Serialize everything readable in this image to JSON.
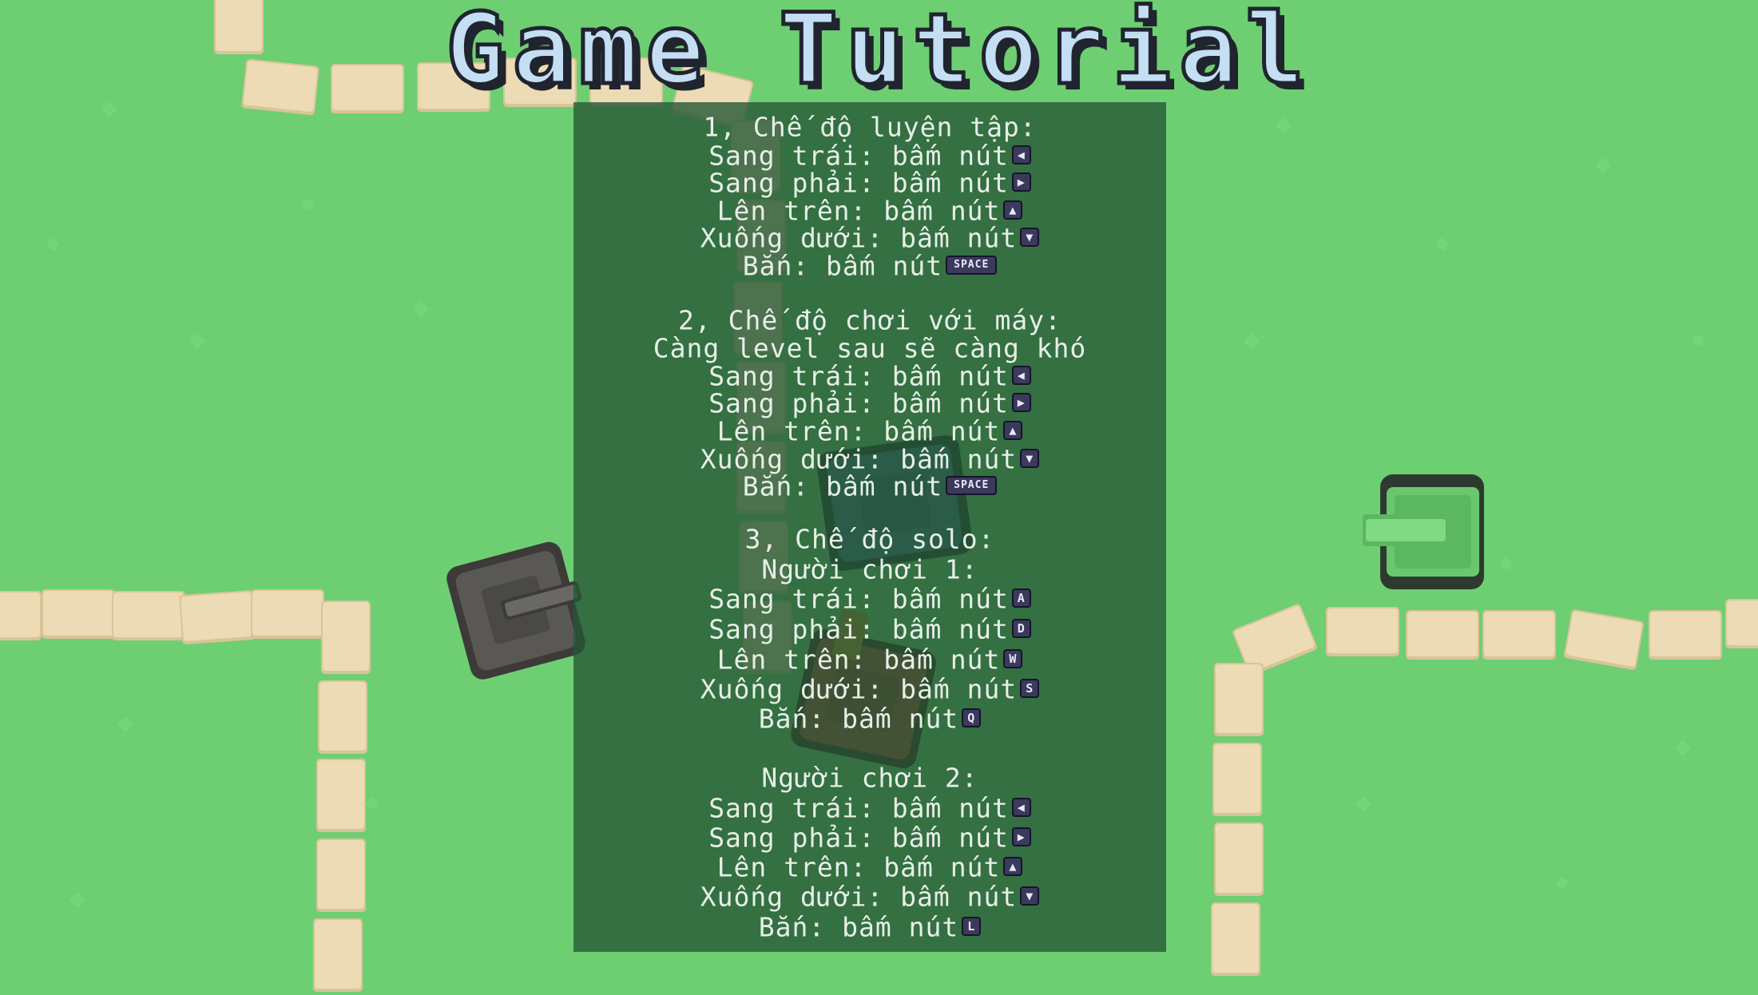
{
  "title": "Game Tutorial",
  "sections": [
    {
      "lines": [
        {
          "text": "1, Chế độ luyện tập:"
        },
        {
          "text": "Sang trái: bấm nút",
          "key": "◀",
          "key_name": "left-arrow-key-icon"
        },
        {
          "text": "Sang phải: bấm nút",
          "key": "▶",
          "key_name": "right-arrow-key-icon"
        },
        {
          "text": "Lên trên: bấm nút",
          "key": "▲",
          "key_name": "up-arrow-key-icon"
        },
        {
          "text": "Xuống dưới: bấm nút",
          "key": "▼",
          "key_name": "down-arrow-key-icon"
        },
        {
          "text": "Bắn: bấm nút",
          "key": "SPACE",
          "key_name": "space-key-icon"
        }
      ]
    },
    {
      "lines": [
        {
          "text": "2, Chế độ chơi với máy:"
        },
        {
          "text": "Càng level sau sẽ càng khó"
        },
        {
          "text": "Sang trái: bấm nút",
          "key": "◀",
          "key_name": "left-arrow-key-icon"
        },
        {
          "text": "Sang phải: bấm nút",
          "key": "▶",
          "key_name": "right-arrow-key-icon"
        },
        {
          "text": "Lên trên: bấm nút",
          "key": "▲",
          "key_name": "up-arrow-key-icon"
        },
        {
          "text": "Xuống dưới: bấm nút",
          "key": "▼",
          "key_name": "down-arrow-key-icon"
        },
        {
          "text": "Bắn: bấm nút",
          "key": "SPACE",
          "key_name": "space-key-icon"
        }
      ]
    },
    {
      "lines": [
        {
          "text": "3, Chế độ solo:"
        },
        {
          "text": "Người chơi 1:"
        },
        {
          "text": "Sang trái: bấm nút",
          "key": "A",
          "key_name": "a-key-icon"
        },
        {
          "text": "Sang phải: bấm nút",
          "key": "D",
          "key_name": "d-key-icon"
        },
        {
          "text": "Lên trên: bấm nút",
          "key": "W",
          "key_name": "w-key-icon"
        },
        {
          "text": "Xuống dưới: bấm nút",
          "key": "S",
          "key_name": "s-key-icon"
        },
        {
          "text": "Bắn: bấm nút",
          "key": "Q",
          "key_name": "q-key-icon"
        }
      ]
    },
    {
      "lines": [
        {
          "text": "Người chơi 2:"
        },
        {
          "text": "Sang trái: bấm nút",
          "key": "◀",
          "key_name": "left-arrow-key-icon"
        },
        {
          "text": "Sang phải: bấm nút",
          "key": "▶",
          "key_name": "right-arrow-key-icon"
        },
        {
          "text": "Lên trên: bấm nút",
          "key": "▲",
          "key_name": "up-arrow-key-icon"
        },
        {
          "text": "Xuống dưới: bấm nút",
          "key": "▼",
          "key_name": "down-arrow-key-icon"
        },
        {
          "text": "Bắn: bấm nút",
          "key": "L",
          "key_name": "l-key-icon"
        }
      ]
    }
  ],
  "colors": {
    "grass": "#6dcf72",
    "wall": "#e9d6ad",
    "panel": "#26583a",
    "title_fill": "#c4def4",
    "tank_green": "#69c86e",
    "tank_gray": "#5a5855",
    "tank_blue": "#3e6d9c",
    "tank_red": "#b8393a"
  }
}
